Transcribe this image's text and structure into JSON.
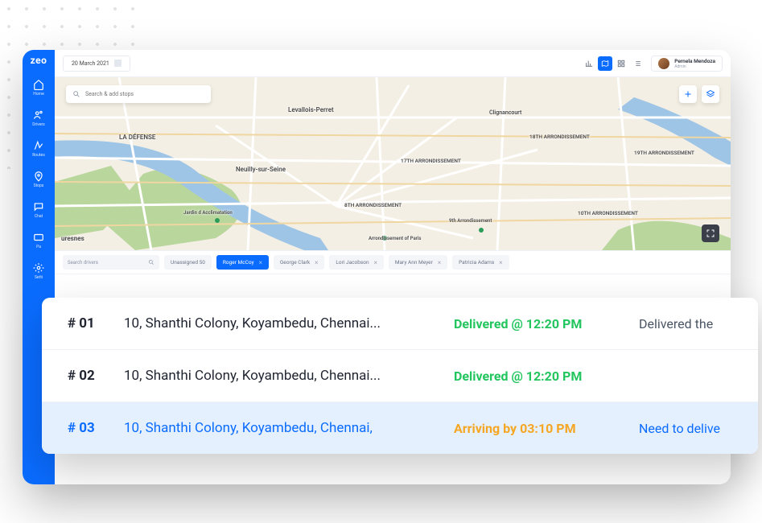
{
  "brand": "zeo",
  "sidebar": {
    "items": [
      {
        "label": "Home"
      },
      {
        "label": "Drivers"
      },
      {
        "label": "Routes"
      },
      {
        "label": "Stops"
      },
      {
        "label": "Chat"
      },
      {
        "label": "Pa"
      },
      {
        "label": "Setti"
      }
    ]
  },
  "topbar": {
    "date": "20 March 2021",
    "user_name": "Pernela Mendoza",
    "user_role": "Admin"
  },
  "search": {
    "placeholder": "Search & add stops"
  },
  "map_labels": {
    "levallois": "Levallois-Perret",
    "la_defense": "LA DÉFENSE",
    "neuilly": "Neuilly-sur-Seine",
    "clignancourt": "Clignancourt",
    "a17": "17TH ARRONDISSEMENT",
    "a18": "18TH ARRONDISSEMENT",
    "a19": "19TH ARRONDISSEMENT",
    "a8": "8TH ARRONDISSEMENT",
    "a9": "9th Arrondissement",
    "a10": "10TH ARRONDISSEMENT",
    "jardin": "Jardin d Acclimatation",
    "suresnes": "uresnes",
    "arr_paris": "Arrondissement of Paris"
  },
  "filter": {
    "search_placeholder": "Search drivers",
    "chips": [
      {
        "label": "Unassigned 50",
        "active": false
      },
      {
        "label": "Roger McCoy",
        "active": true
      },
      {
        "label": "George Clark",
        "active": false
      },
      {
        "label": "Lori Jacobson",
        "active": false
      },
      {
        "label": "Mary Ann Meyer",
        "active": false
      },
      {
        "label": "Patricia Adams",
        "active": false
      }
    ]
  },
  "stops": [
    {
      "num": "# 01",
      "addr": "10, Shanthi Colony, Koyambedu, Chennai...",
      "status": "Delivered @ 12:20 PM",
      "status_class": "delivered",
      "notes": "Delivered the "
    },
    {
      "num": "# 02",
      "addr": "10, Shanthi Colony, Koyambedu, Chennai...",
      "status": "Delivered @ 12:20 PM",
      "status_class": "delivered",
      "notes": ""
    },
    {
      "num": "# 03",
      "addr": "10, Shanthi Colony, Koyambedu, Chennai,",
      "status": "Arriving by 03:10 PM",
      "status_class": "arriving",
      "notes": "Need to delive"
    }
  ],
  "colors": {
    "brand": "#0a6cff",
    "success": "#22c55e",
    "warning": "#f5a623"
  }
}
